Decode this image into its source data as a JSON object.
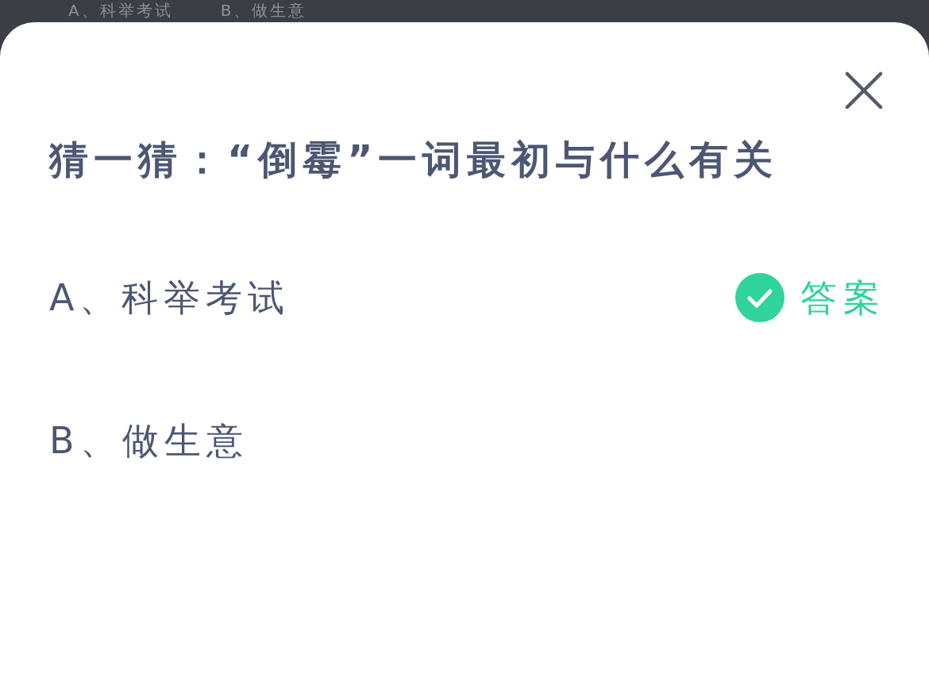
{
  "background": {
    "options": [
      "A、科举考试",
      "B、做生意"
    ]
  },
  "sheet": {
    "title": "猜一猜：“倒霉”一词最初与什么有关",
    "options": [
      {
        "text": "A、科举考试",
        "correct": true,
        "badge": "答案"
      },
      {
        "text": "B、做生意",
        "correct": false
      }
    ]
  }
}
